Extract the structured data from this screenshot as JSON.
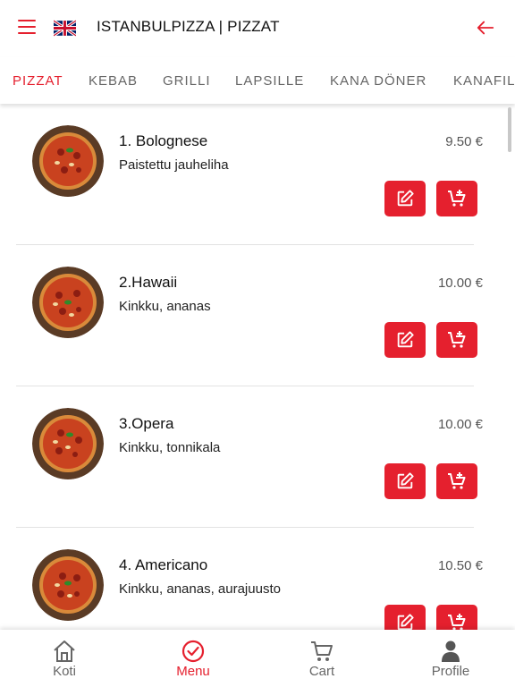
{
  "header": {
    "title": "ISTANBULPIZZA | PIZZAT",
    "menu_icon": "hamburger-menu-icon",
    "flag_icon": "uk-flag-icon",
    "back_icon": "arrow-left-icon"
  },
  "colors": {
    "accent": "#e5202e",
    "text": "#222222",
    "muted": "#666666"
  },
  "tabs": [
    {
      "label": "PIZZAT",
      "active": true
    },
    {
      "label": "KEBAB",
      "active": false
    },
    {
      "label": "GRILLI",
      "active": false
    },
    {
      "label": "LAPSILLE",
      "active": false
    },
    {
      "label": "KANA DÖNER",
      "active": false
    },
    {
      "label": "KANAFILE",
      "active": false
    }
  ],
  "items": [
    {
      "name": "1. Bolognese",
      "description": "Paistettu jauheliha",
      "price": "9.50 €"
    },
    {
      "name": "2.Hawaii",
      "description": "Kinkku, ananas",
      "price": "10.00 €"
    },
    {
      "name": "3.Opera",
      "description": "Kinkku, tonnikala",
      "price": "10.00 €"
    },
    {
      "name": "4. Americano",
      "description": "Kinkku, ananas, aurajuusto",
      "price": "10.50 €"
    }
  ],
  "item_actions": {
    "edit_icon": "edit-icon",
    "add_to_cart_icon": "add-to-cart-icon"
  },
  "bottom_nav": [
    {
      "label": "Koti",
      "icon": "home-icon",
      "active": false
    },
    {
      "label": "Menu",
      "icon": "check-circle-icon",
      "active": true
    },
    {
      "label": "Cart",
      "icon": "cart-icon",
      "active": false
    },
    {
      "label": "Profile",
      "icon": "person-icon",
      "active": false
    }
  ]
}
